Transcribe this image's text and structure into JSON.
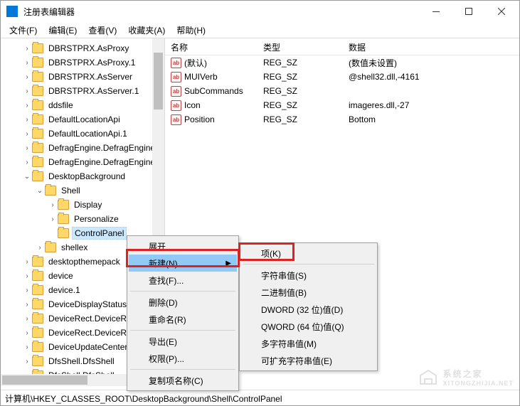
{
  "window": {
    "title": "注册表编辑器"
  },
  "menubar": [
    {
      "label": "文件(F)"
    },
    {
      "label": "编辑(E)"
    },
    {
      "label": "查看(V)"
    },
    {
      "label": "收藏夹(A)"
    },
    {
      "label": "帮助(H)"
    }
  ],
  "tree": [
    {
      "indent": 0,
      "exp": "›",
      "label": "DBRSTPRX.AsProxy"
    },
    {
      "indent": 0,
      "exp": "›",
      "label": "DBRSTPRX.AsProxy.1"
    },
    {
      "indent": 0,
      "exp": "›",
      "label": "DBRSTPRX.AsServer"
    },
    {
      "indent": 0,
      "exp": "›",
      "label": "DBRSTPRX.AsServer.1"
    },
    {
      "indent": 0,
      "exp": "›",
      "label": "ddsfile"
    },
    {
      "indent": 0,
      "exp": "›",
      "label": "DefaultLocationApi"
    },
    {
      "indent": 0,
      "exp": "›",
      "label": "DefaultLocationApi.1"
    },
    {
      "indent": 0,
      "exp": "›",
      "label": "DefragEngine.DefragEngine"
    },
    {
      "indent": 0,
      "exp": "›",
      "label": "DefragEngine.DefragEngine"
    },
    {
      "indent": 0,
      "exp": "⌄",
      "label": "DesktopBackground"
    },
    {
      "indent": 1,
      "exp": "⌄",
      "label": "Shell"
    },
    {
      "indent": 2,
      "exp": "›",
      "label": "Display"
    },
    {
      "indent": 2,
      "exp": "›",
      "label": "Personalize"
    },
    {
      "indent": 2,
      "exp": "",
      "label": "ControlPanel",
      "selected": true
    },
    {
      "indent": 1,
      "exp": "›",
      "label": "shellex"
    },
    {
      "indent": 0,
      "exp": "›",
      "label": "desktopthemepack"
    },
    {
      "indent": 0,
      "exp": "›",
      "label": "device"
    },
    {
      "indent": 0,
      "exp": "›",
      "label": "device.1"
    },
    {
      "indent": 0,
      "exp": "›",
      "label": "DeviceDisplayStatus"
    },
    {
      "indent": 0,
      "exp": "›",
      "label": "DeviceRect.DeviceRect"
    },
    {
      "indent": 0,
      "exp": "›",
      "label": "DeviceRect.DeviceRect"
    },
    {
      "indent": 0,
      "exp": "›",
      "label": "DeviceUpdateCenter"
    },
    {
      "indent": 0,
      "exp": "›",
      "label": "DfsShell.DfsShell"
    },
    {
      "indent": 0,
      "exp": "›",
      "label": "DfsShell.DfsShell"
    }
  ],
  "columns": {
    "name": "名称",
    "type": "类型",
    "data": "数据"
  },
  "values": [
    {
      "name": "(默认)",
      "type": "REG_SZ",
      "data": "(数值未设置)"
    },
    {
      "name": "MUIVerb",
      "type": "REG_SZ",
      "data": "@shell32.dll,-4161"
    },
    {
      "name": "SubCommands",
      "type": "REG_SZ",
      "data": ""
    },
    {
      "name": "Icon",
      "type": "REG_SZ",
      "data": "imageres.dll,-27"
    },
    {
      "name": "Position",
      "type": "REG_SZ",
      "data": "Bottom"
    }
  ],
  "context_menu_1": [
    {
      "label": "展开",
      "type": "item"
    },
    {
      "label": "新建(N)",
      "type": "item",
      "submenu": true,
      "highlighted": true
    },
    {
      "label": "查找(F)...",
      "type": "item"
    },
    {
      "type": "sep"
    },
    {
      "label": "删除(D)",
      "type": "item"
    },
    {
      "label": "重命名(R)",
      "type": "item"
    },
    {
      "type": "sep"
    },
    {
      "label": "导出(E)",
      "type": "item"
    },
    {
      "label": "权限(P)...",
      "type": "item"
    },
    {
      "type": "sep"
    },
    {
      "label": "复制项名称(C)",
      "type": "item"
    }
  ],
  "context_menu_2": [
    {
      "label": "项(K)",
      "type": "item"
    },
    {
      "type": "sep"
    },
    {
      "label": "字符串值(S)",
      "type": "item"
    },
    {
      "label": "二进制值(B)",
      "type": "item"
    },
    {
      "label": "DWORD (32 位)值(D)",
      "type": "item"
    },
    {
      "label": "QWORD (64 位)值(Q)",
      "type": "item"
    },
    {
      "label": "多字符串值(M)",
      "type": "item"
    },
    {
      "label": "可扩充字符串值(E)",
      "type": "item"
    }
  ],
  "statusbar": {
    "path": "计算机\\HKEY_CLASSES_ROOT\\DesktopBackground\\Shell\\ControlPanel"
  },
  "watermark": {
    "main": "系统之家",
    "sub": "XITONGZHIJIA.NET"
  }
}
